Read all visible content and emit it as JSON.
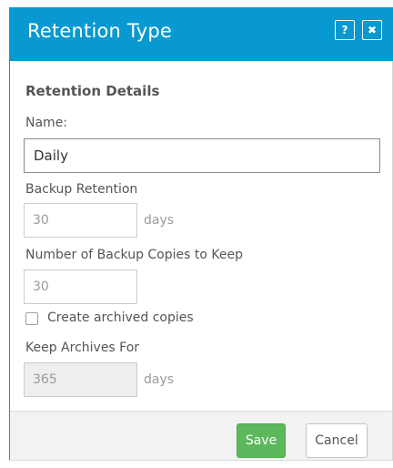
{
  "dialog": {
    "title": "Retention Type",
    "help_label": "?",
    "close_label": "✖"
  },
  "form": {
    "section_title": "Retention Details",
    "name_label": "Name:",
    "name_value": "Daily",
    "backup_retention_label": "Backup Retention",
    "backup_retention_value": "30",
    "backup_retention_unit": "days",
    "copies_label": "Number of Backup Copies to Keep",
    "copies_value": "30",
    "archive_checkbox_label": "Create archived copies",
    "archive_checked": false,
    "keep_archives_label": "Keep Archives For",
    "keep_archives_value": "365",
    "keep_archives_unit": "days"
  },
  "footer": {
    "save_label": "Save",
    "cancel_label": "Cancel"
  },
  "colors": {
    "header_bg": "#0899d1",
    "save_bg": "#5cb85c",
    "footer_bg": "#f2f2f2"
  },
  "icons": {
    "help": "question-icon",
    "close": "close-icon"
  }
}
